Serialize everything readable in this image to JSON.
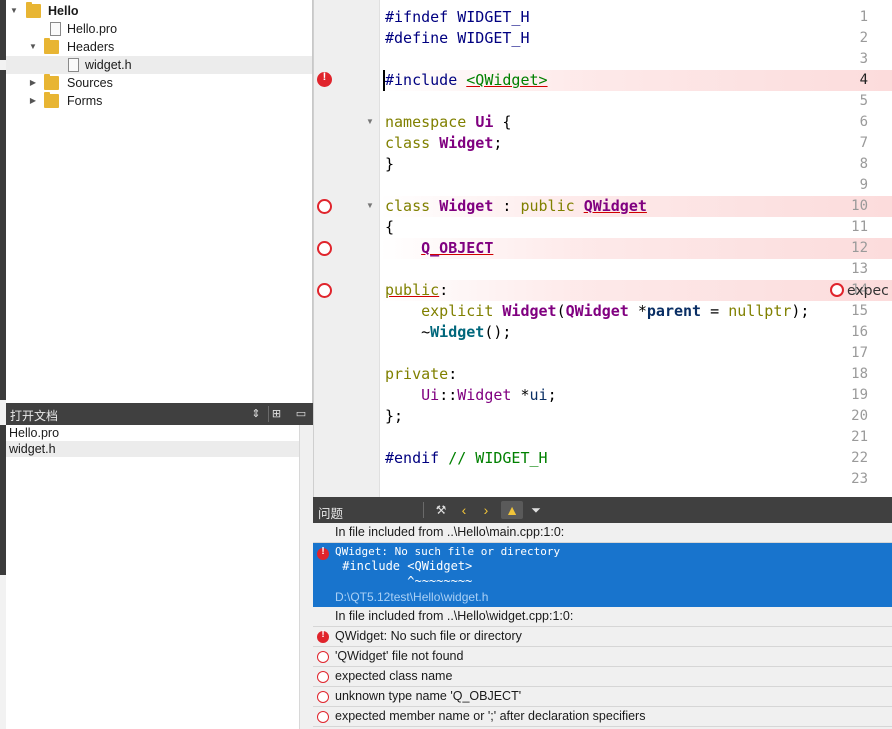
{
  "project_tree": {
    "items": [
      {
        "label": "Hello",
        "icon": "qt-project-folder-icon",
        "expanded": true
      },
      {
        "label": "Hello.pro",
        "icon": "qt-pro-file-icon"
      },
      {
        "label": "Headers",
        "icon": "headers-folder-icon",
        "expanded": true
      },
      {
        "label": "widget.h",
        "icon": "header-file-icon",
        "selected": true
      },
      {
        "label": "Sources",
        "icon": "sources-folder-icon",
        "expanded": false
      },
      {
        "label": "Forms",
        "icon": "forms-folder-icon",
        "expanded": false
      }
    ]
  },
  "open_documents": {
    "title": "打开文档",
    "items": [
      "Hello.pro",
      "widget.h"
    ],
    "selected": "widget.h"
  },
  "editor": {
    "current_line": "4",
    "lines": [
      {
        "n": "1"
      },
      {
        "n": "2"
      },
      {
        "n": "3"
      },
      {
        "n": "4"
      },
      {
        "n": "5"
      },
      {
        "n": "6"
      },
      {
        "n": "7"
      },
      {
        "n": "8"
      },
      {
        "n": "9"
      },
      {
        "n": "10"
      },
      {
        "n": "11"
      },
      {
        "n": "12"
      },
      {
        "n": "13"
      },
      {
        "n": "14"
      },
      {
        "n": "15"
      },
      {
        "n": "16"
      },
      {
        "n": "17"
      },
      {
        "n": "18"
      },
      {
        "n": "19"
      },
      {
        "n": "20"
      },
      {
        "n": "21"
      },
      {
        "n": "22"
      },
      {
        "n": "23"
      }
    ],
    "code": {
      "l1_a": "#ifndef ",
      "l1_b": "WIDGET_H",
      "l2_a": "#define ",
      "l2_b": "WIDGET_H",
      "l4_a": "#include ",
      "l4_b": "<QWidget>",
      "l6_a": "namespace ",
      "l6_b": "Ui",
      "l6_c": " {",
      "l7_a": "class ",
      "l7_b": "Widget",
      "l7_c": ";",
      "l8": "}",
      "l10_a": "class ",
      "l10_b": "Widget",
      "l10_c": " : ",
      "l10_d": "public ",
      "l10_e": "QWidget",
      "l11": "{",
      "l12_a": "    ",
      "l12_b": "Q_OBJECT",
      "l14_a": "public",
      "l14_b": ":",
      "l15_a": "    ",
      "l15_b": "explicit ",
      "l15_c": "Widget",
      "l15_d": "(",
      "l15_e": "QWidget",
      "l15_f": " *",
      "l15_g": "parent",
      "l15_h": " = ",
      "l15_i": "nullptr",
      "l15_j": ");",
      "l16_a": "    ~",
      "l16_b": "Widget",
      "l16_c": "();",
      "l18_a": "private",
      "l18_b": ":",
      "l19_a": "    ",
      "l19_b": "Ui",
      "l19_c": "::",
      "l19_d": "Widget",
      "l19_e": " *",
      "l19_f": "ui",
      "l19_g": ";",
      "l20": "};",
      "l22_a": "#endif ",
      "l22_b": "// WIDGET_H"
    },
    "inline_error": "expec"
  },
  "issues_pane": {
    "title": "问题",
    "buttons": [
      "build-filter-icon",
      "previous-icon",
      "next-icon",
      "warning-filter-icon",
      "filter-icon"
    ],
    "items": [
      {
        "type": "info",
        "text": "In file included from ..\\Hello\\main.cpp:1:0:"
      },
      {
        "type": "error-selected",
        "text": "QWidget: No such file or directory",
        "detail1": " #include <QWidget>",
        "detail2": "          ^~~~~~~~~",
        "path": "D:\\QT5.12test\\Hello\\widget.h"
      },
      {
        "type": "info",
        "text": "In file included from ..\\Hello\\widget.cpp:1:0:"
      },
      {
        "type": "error",
        "text": "QWidget: No such file or directory"
      },
      {
        "type": "error-ring",
        "text": "'QWidget' file not found"
      },
      {
        "type": "error-ring",
        "text": "expected class name"
      },
      {
        "type": "error-ring",
        "text": "unknown type name 'Q_OBJECT'"
      },
      {
        "type": "error-ring",
        "text": "expected member name or ';' after declaration specifiers"
      }
    ]
  },
  "colors": {
    "accent_selection": "#1874cd",
    "error_red": "#e0242c",
    "panel_header": "#404040"
  }
}
